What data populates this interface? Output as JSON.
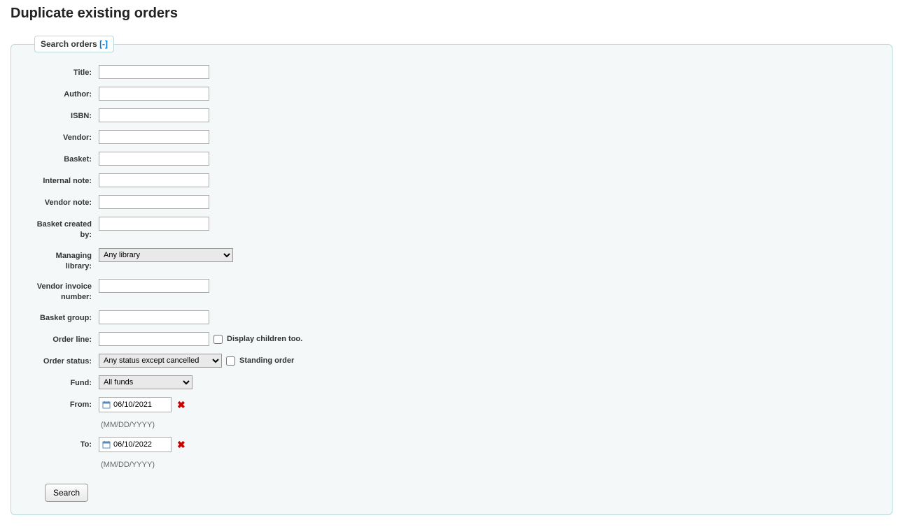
{
  "page_title": "Duplicate existing orders",
  "fieldset": {
    "legend_text": "Search orders",
    "toggle_text": "[-]"
  },
  "labels": {
    "title": "Title:",
    "author": "Author:",
    "isbn": "ISBN:",
    "vendor": "Vendor:",
    "basket": "Basket:",
    "internal_note": "Internal note:",
    "vendor_note": "Vendor note:",
    "basket_created_by": "Basket created by:",
    "managing_library": "Managing library:",
    "vendor_invoice_number": "Vendor invoice number:",
    "basket_group": "Basket group:",
    "order_line": "Order line:",
    "order_status": "Order status:",
    "fund": "Fund:",
    "from": "From:",
    "to": "To:"
  },
  "values": {
    "title": "",
    "author": "",
    "isbn": "",
    "vendor": "",
    "basket": "",
    "internal_note": "",
    "vendor_note": "",
    "basket_created_by": "",
    "vendor_invoice_number": "",
    "basket_group": "",
    "order_line": "",
    "from_date": "06/10/2021",
    "to_date": "06/10/2022"
  },
  "selects": {
    "managing_library": {
      "selected": "Any library"
    },
    "order_status": {
      "selected": "Any status except cancelled"
    },
    "fund": {
      "selected": "All funds"
    }
  },
  "checkboxes": {
    "display_children": {
      "label": "Display children too.",
      "checked": false
    },
    "standing_order": {
      "label": "Standing order",
      "checked": false
    }
  },
  "date_hint": "(MM/DD/YYYY)",
  "buttons": {
    "search": "Search"
  }
}
